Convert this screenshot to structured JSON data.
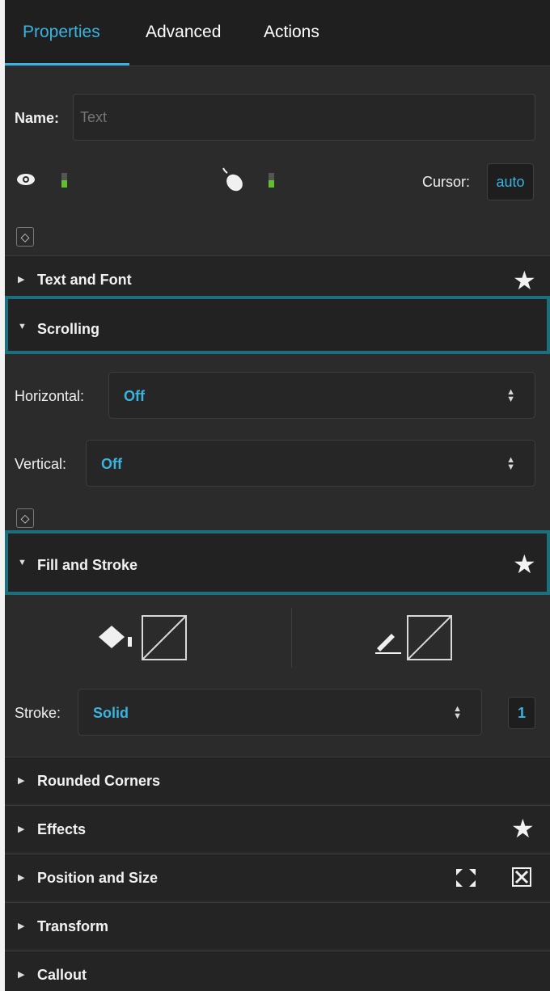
{
  "tabs": [
    {
      "label": "Properties",
      "active": true
    },
    {
      "label": "Advanced",
      "active": false
    },
    {
      "label": "Actions",
      "active": false
    }
  ],
  "name_field": {
    "label": "Name:",
    "placeholder": "Text",
    "value": ""
  },
  "visibility": {
    "icon": "eye-icon",
    "level": 0.5
  },
  "mouse": {
    "icon": "mouse-icon",
    "level": 0.5
  },
  "cursor": {
    "label": "Cursor:",
    "value": "auto"
  },
  "sections": {
    "text_and_font": "Text and Font",
    "scrolling": "Scrolling",
    "fill_and_stroke": "Fill and Stroke",
    "rounded_corners": "Rounded Corners",
    "effects": "Effects",
    "position_and_size": "Position and Size",
    "transform": "Transform",
    "callout": "Callout"
  },
  "scrolling": {
    "horizontal_label": "Horizontal:",
    "horizontal_value": "Off",
    "vertical_label": "Vertical:",
    "vertical_value": "Off"
  },
  "stroke": {
    "label": "Stroke:",
    "value": "Solid",
    "width": "1"
  },
  "colors": {
    "accent": "#3bb3e0",
    "highlight_border": "#1e6f7d",
    "indicator": "#5fbf2e",
    "panel": "#2b2b2b"
  }
}
